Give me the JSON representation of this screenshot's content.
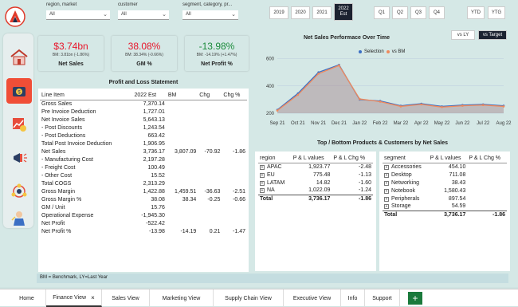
{
  "filters": [
    {
      "label": "region, market",
      "value": "All"
    },
    {
      "label": "customer",
      "value": "All"
    },
    {
      "label": "segment, category, pr...",
      "value": "All"
    }
  ],
  "years": [
    "2019",
    "2020",
    "2021",
    "2022",
    "Est"
  ],
  "quarters": [
    "Q1",
    "Q2",
    "Q3",
    "Q4"
  ],
  "ytd": "YTD",
  "ytg": "YTG",
  "kpis": [
    {
      "value": "$3.74bn",
      "sub": "BM: 3.81bn (-1.86%)",
      "name": "Net Sales",
      "color": "#c3c3c3",
      "valcolor": "#e8152a"
    },
    {
      "value": "38.08%",
      "sub": "BM: 38.34% (-0.66%)",
      "name": "GM %",
      "color": "#f0b6a1",
      "valcolor": "#e8152a"
    },
    {
      "value": "-13.98%",
      "sub": "BM: -14.19% (+1.47%)",
      "name": "Net Profit %",
      "color": "#c8cbf0",
      "valcolor": "#1a8a3a"
    }
  ],
  "pl": {
    "title": "Profit and Loss Statement",
    "headers": [
      "Line Item",
      "2022 Est",
      "BM",
      "Chg",
      "Chg %"
    ],
    "rows": [
      [
        "Gross Sales",
        "7,370.14",
        "",
        "",
        ""
      ],
      [
        "Pre Invoice Deduction",
        "1,727.01",
        "",
        "",
        ""
      ],
      [
        "Net Invoice Sales",
        "5,643.13",
        "",
        "",
        ""
      ],
      [
        "- Post Discounts",
        "1,243.54",
        "",
        "",
        ""
      ],
      [
        "- Post Deductions",
        "663.42",
        "",
        "",
        ""
      ],
      [
        "Total Post Invoice Deduction",
        "1,906.95",
        "",
        "",
        ""
      ],
      [
        "Net Sales",
        "3,736.17",
        "3,807.09",
        "-70.92",
        "-1.86"
      ],
      [
        "- Manufacturing Cost",
        "2,197.28",
        "",
        "",
        ""
      ],
      [
        "- Freight Cost",
        "100.49",
        "",
        "",
        ""
      ],
      [
        "- Other Cost",
        "15.52",
        "",
        "",
        ""
      ],
      [
        "Total COGS",
        "2,313.29",
        "",
        "",
        ""
      ],
      [
        "Gross Margin",
        "1,422.88",
        "1,459.51",
        "-36.63",
        "-2.51"
      ],
      [
        "Gross Margin %",
        "38.08",
        "38.34",
        "-0.25",
        "-0.66"
      ],
      [
        "GM / Unit",
        "15.76",
        "",
        "",
        ""
      ],
      [
        "Operational Expense",
        "-1,945.30",
        "",
        "",
        ""
      ],
      [
        "Net Profit",
        "-522.42",
        "",
        "",
        ""
      ],
      [
        "Net Profit %",
        "-13.98",
        "-14.19",
        "0.21",
        "-1.47"
      ]
    ]
  },
  "footnote": "BM = Benchmark, LY=Last Year",
  "trend": {
    "title": "Net Sales Performace Over Time",
    "toggle_ly": "vs LY",
    "toggle_target": "vs Target",
    "legend_selection": "Selection",
    "legend_bm": "vs BM",
    "color_selection": "#3b6fc4",
    "color_bm": "#f08a5d"
  },
  "chart_data": {
    "type": "area",
    "title": "Net Sales Performace Over Time",
    "categories": [
      "Sep 21",
      "Oct 21",
      "Nov 21",
      "Dec 21",
      "Jan 22",
      "Feb 22",
      "Mar 22",
      "Apr 22",
      "May 22",
      "Jun 22",
      "Jul 22",
      "Aug 22"
    ],
    "yticks": [
      "600",
      "400",
      "200"
    ],
    "ylim": [
      200,
      650
    ],
    "series": [
      {
        "name": "Selection",
        "values": [
          225,
          345,
          500,
          555,
          300,
          290,
          255,
          270,
          250,
          260,
          265,
          255
        ]
      },
      {
        "name": "vs BM",
        "values": [
          220,
          335,
          490,
          550,
          305,
          285,
          250,
          265,
          245,
          255,
          260,
          250
        ]
      }
    ]
  },
  "top_bottom_title": "Top / Bottom Products & Customers by Net Sales",
  "region_table": {
    "headers": [
      "region",
      "P & L values",
      "P & L Chg %"
    ],
    "rows": [
      [
        "APAC",
        "1,923.77",
        "-2.48"
      ],
      [
        "EU",
        "775.48",
        "-1.13"
      ],
      [
        "LATAM",
        "14.82",
        "-1.60"
      ],
      [
        "NA",
        "1,022.09",
        "-1.24"
      ]
    ],
    "total": [
      "Total",
      "3,736.17",
      "-1.86"
    ]
  },
  "segment_table": {
    "headers": [
      "segment",
      "P & L values",
      "P & L Chg %"
    ],
    "rows": [
      [
        "Accessories",
        "454.10",
        ""
      ],
      [
        "Desktop",
        "711.08",
        ""
      ],
      [
        "Networking",
        "38.43",
        ""
      ],
      [
        "Notebook",
        "1,580.43",
        ""
      ],
      [
        "Peripherals",
        "897.54",
        ""
      ],
      [
        "Storage",
        "54.59",
        ""
      ]
    ],
    "total": [
      "Total",
      "3,736.17",
      "-1.86"
    ]
  },
  "tabs": [
    "Home",
    "Finance View",
    "Sales View",
    "Marketing View",
    "Supply Chain View",
    "Executive View",
    "Info",
    "Support"
  ],
  "tab_close": "×",
  "tab_add": "+"
}
